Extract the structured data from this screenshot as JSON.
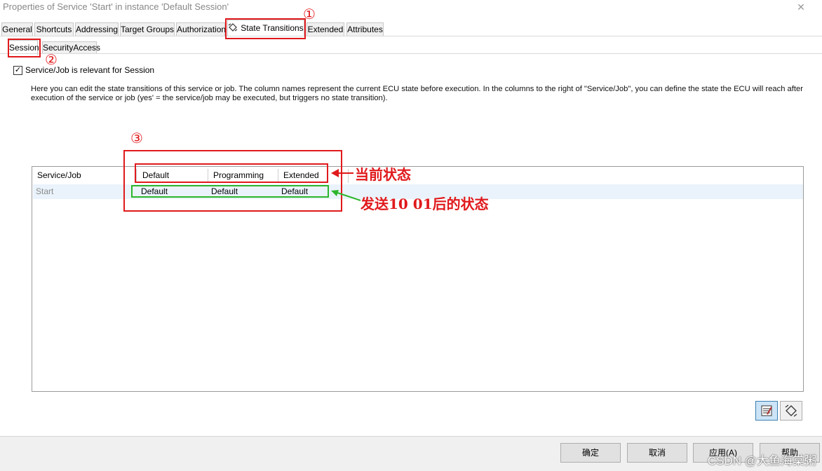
{
  "window": {
    "title": "Properties of Service 'Start' in instance 'Default Session'",
    "close_glyph": "✕"
  },
  "tabs": [
    {
      "label": "General",
      "active": false
    },
    {
      "label": "Shortcuts",
      "active": false
    },
    {
      "label": "Addressing",
      "active": false
    },
    {
      "label": "Target Groups",
      "active": false
    },
    {
      "label": "Authorization",
      "active": false
    },
    {
      "label": "State Transitions",
      "active": true
    },
    {
      "label": "Extended",
      "active": false
    },
    {
      "label": "Attributes",
      "active": false
    }
  ],
  "subtabs": [
    {
      "label": "Session",
      "active": true
    },
    {
      "label": "SecurityAccess",
      "active": false
    }
  ],
  "checkbox": {
    "label": "Service/Job is relevant for Session",
    "checked": true,
    "mark": "✓"
  },
  "description": "Here you can edit the state transitions of this service or job. The column names represent the current ECU state before execution. In the columns to the right of \"Service/Job\", you can define the state the ECU will reach after execution of the service or job (yes' = the service/job may be executed, but triggers no state transition).",
  "grid": {
    "columns": [
      "Service/Job",
      "Default",
      "Programming",
      "Extended"
    ],
    "rows": [
      {
        "service": "Start",
        "cells": [
          "Default",
          "Default",
          "Default"
        ]
      }
    ]
  },
  "annotations": {
    "marker_1": "①",
    "marker_2": "②",
    "marker_3": "③",
    "current_state": "当前状态",
    "after_send": "发送10 01后的状态"
  },
  "toolbar": [
    {
      "icon": "edit-table-icon",
      "selected": true
    },
    {
      "icon": "state-transition-icon",
      "selected": false
    }
  ],
  "footer_buttons": [
    "确定",
    "取消",
    "应用(A)",
    "帮助"
  ],
  "watermark": "CSDN @大鱼海棠粥",
  "colors": {
    "annotation_red": "#e0191c",
    "annotation_green": "#2cb52c",
    "row_highlight": "#eaf3fb"
  }
}
